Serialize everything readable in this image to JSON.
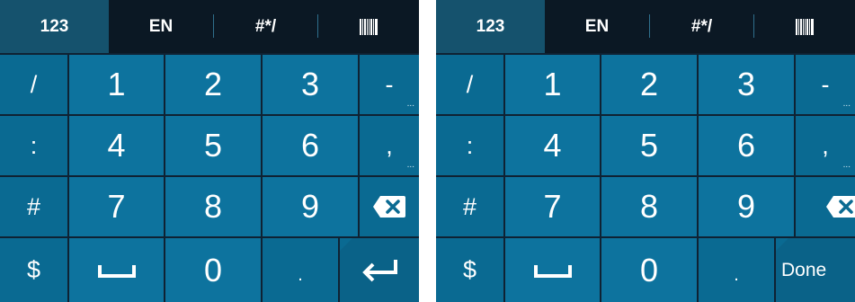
{
  "keyboards": [
    {
      "id": "left",
      "tabs": {
        "numeric": "123",
        "language": "EN",
        "symbols": "#*/",
        "barcode_icon": "barcode-icon"
      },
      "rows": [
        {
          "side": "/",
          "keys": [
            "1",
            "2",
            "3"
          ],
          "extra": "-",
          "extra_more": "..."
        },
        {
          "side": ":",
          "keys": [
            "4",
            "5",
            "6"
          ],
          "extra": ",",
          "extra_more": "..."
        },
        {
          "side": "#",
          "keys": [
            "7",
            "8",
            "9"
          ],
          "extra_icon": "backspace-icon"
        },
        {
          "side": "$",
          "space_icon": "space-bar-icon",
          "zero": "0",
          "dot": ".",
          "action_icon": "enter-arrow-icon"
        }
      ]
    },
    {
      "id": "right",
      "tabs": {
        "numeric": "123",
        "language": "EN",
        "symbols": "#*/",
        "barcode_icon": "barcode-icon"
      },
      "rows": [
        {
          "side": "/",
          "keys": [
            "1",
            "2",
            "3"
          ],
          "extra": "-",
          "extra_more": "..."
        },
        {
          "side": ":",
          "keys": [
            "4",
            "5",
            "6"
          ],
          "extra": ",",
          "extra_more": "..."
        },
        {
          "side": "#",
          "keys": [
            "7",
            "8",
            "9"
          ],
          "extra_icon": "backspace-icon"
        },
        {
          "side": "$",
          "space_icon": "space-bar-icon",
          "zero": "0",
          "dot": ".",
          "action_label": "Done"
        }
      ]
    }
  ],
  "colors": {
    "background": "#0f2233",
    "tab_bar": "#0b1824",
    "tab_active": "#15526d",
    "key": "#0d739e",
    "key_text": "#ffffff"
  }
}
